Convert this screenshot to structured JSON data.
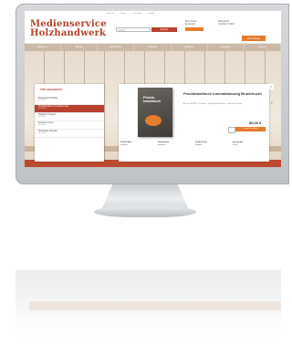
{
  "site": {
    "top_links": [
      "Über uns",
      "Service",
      "Newsletter",
      "Kontakt"
    ],
    "logo_line1": "Medienservice",
    "logo_line2": "Holzhandwerk",
    "search_placeholder": "Suche",
    "search_button": "Suchen",
    "account_label": "Mein Konto",
    "account_sub": "Anmelden",
    "cart_label": "Warenkorb",
    "cart_sub": "0 Artikel / 0,00 €",
    "cart_button": "Zur Kasse",
    "nav": [
      "Startseite",
      "Bücher",
      "Zeitschriften",
      "E-Books",
      "Software",
      "Angebote",
      "Service"
    ]
  },
  "sidebar": {
    "title": "TOP-ANGEBOTE",
    "items": [
      {
        "label": "Musterbuch Holzbau",
        "sub": "ab 29,90 €"
      },
      {
        "label": "Praxishandbuch Innendämmung",
        "sub": "Bruckfrucht"
      },
      {
        "label": "Handbuch Treppen",
        "sub": "ab 45,00 €"
      },
      {
        "label": "Fenster & Türen",
        "sub": "ab 39,00 €"
      },
      {
        "label": "Holzschutz kompakt",
        "sub": "ab 19,90 €"
      }
    ]
  },
  "product": {
    "book_title": "Praxis-\nhandbuch",
    "title": "Praxishandbuch Innendämmung Bruckfrucht",
    "meta": "Art.-Nr. 1234567 · Fachbuch · Verlag Holzhandwerk · Lieferzeit 2-3 Tage",
    "price": "89,00 €",
    "add_to_cart": "In den Warenkorb",
    "thumbs": [
      {
        "title": "Holzbau-Atlas",
        "sub": "Fachbuch"
      },
      {
        "title": "Dachdeckung",
        "sub": "Handbuch"
      },
      {
        "title": "Tischler-Praxis",
        "sub": "Ratgeber"
      },
      {
        "title": "Innenausbau",
        "sub": "Praxis"
      }
    ]
  },
  "colors": {
    "brand_red": "#b8412e",
    "accent_orange": "#e57b2d",
    "nav_tan": "#c9b9a6"
  }
}
